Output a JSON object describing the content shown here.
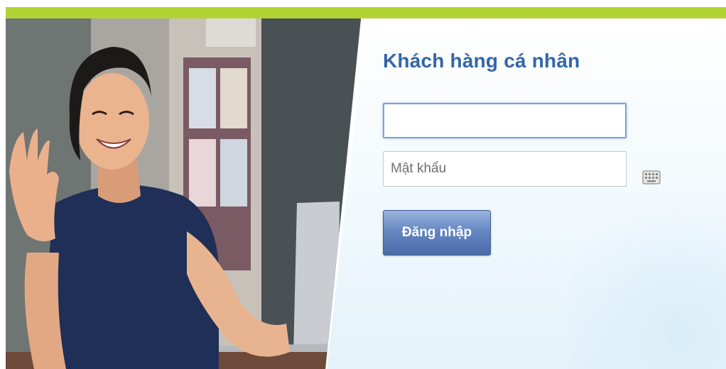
{
  "login": {
    "title": "Khách hàng cá nhân",
    "username_value": "",
    "password_placeholder": "Mật khẩu",
    "submit_label": "Đăng nhập"
  },
  "colors": {
    "top_bar": "#b3d335",
    "title": "#3366a8",
    "button": "#5877b5"
  },
  "icons": {
    "virtual_keyboard": "keyboard-icon"
  }
}
